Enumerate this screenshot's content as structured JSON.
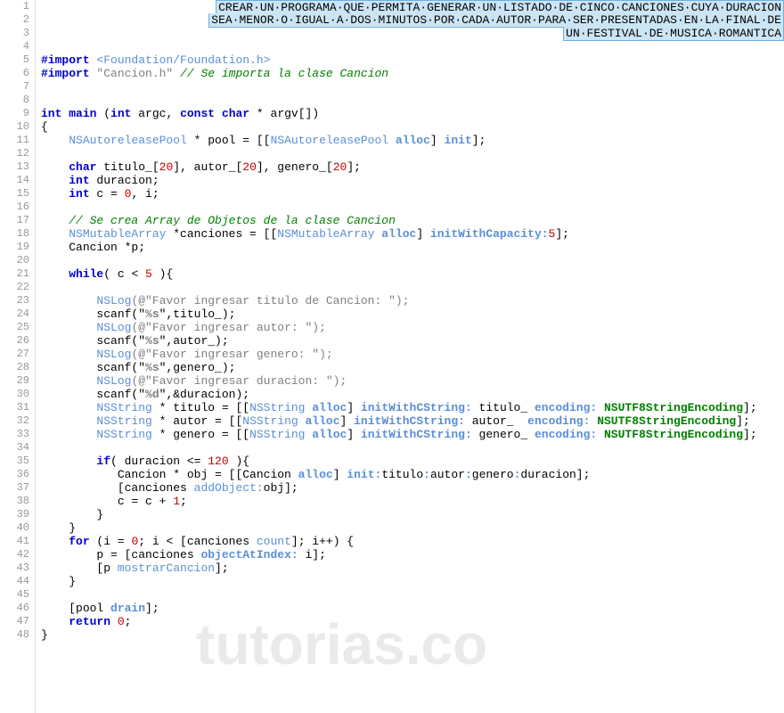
{
  "watermark": "tutorias.co",
  "header": {
    "line1": "CREAR·UN·PROGRAMA·QUE·PERMITA·GENERAR·UN·LISTADO·DE·CINCO·CANCIONES·CUYA·DURACION",
    "line2": "SEA·MENOR·O·IGUAL·A·DOS·MINUTOS·POR·CADA·AUTOR·PARA·SER·PRESENTADAS·EN·LA·FINAL·DE",
    "line3": "UN·FESTIVAL·DE·MUSICA·ROMANTICA"
  },
  "lineCount": 48,
  "code": {
    "import1_kw": "#import",
    "import1_path": "<Foundation/Foundation.h>",
    "import2_kw": "#import",
    "import2_path": "\"Cancion.h\"",
    "import2_cmt": "// Se importa la clase Cancion",
    "main_sig_int": "int",
    "main_sig_main": "main",
    "main_sig_int2": "int",
    "main_sig_argc": " argc, ",
    "main_sig_const": "const",
    "main_sig_char": "char",
    "main_sig_rest": " * argv[])",
    "pool_cls": "NSAutoreleasePool",
    "pool_mid": " * pool = [[",
    "pool_cls2": "NSAutoreleasePool",
    "pool_alloc": "alloc",
    "pool_init": "init",
    "char_kw": "char",
    "char_vars": " titulo_[",
    "char_20a": "20",
    "char_mid1": "], autor_[",
    "char_20b": "20",
    "char_mid2": "], genero_[",
    "char_20c": "20",
    "char_end": "];",
    "int_dur_kw": "int",
    "int_dur": " duracion;",
    "int_c_kw": "int",
    "int_c_mid": " c = ",
    "int_c_0": "0",
    "int_c_end": ", i;",
    "cmt_array": "// Se crea Array de Objetos de la clase Cancion",
    "nsma_cls": "NSMutableArray",
    "nsma_mid": " *canciones = [[",
    "nsma_cls2": "NSMutableArray",
    "nsma_alloc": "alloc",
    "nsma_init": "initWithCapacity:",
    "nsma_5": "5",
    "cancion_p": "Cancion *p;",
    "while_kw": "while",
    "while_cond": "( c < ",
    "while_5": "5",
    "while_end": " ){",
    "nslog": "NSLog",
    "nslog_titulo": "(@\"Favor ingresar titulo de Cancion: \");",
    "scanf_titulo": "scanf(\"",
    "fmt_s": "%s",
    "scanf_titulo_end": "\",titulo_);",
    "nslog_autor": "(@\"Favor ingresar autor: \");",
    "scanf_autor_end": "\",autor_);",
    "nslog_genero": "(@\"Favor ingresar genero: \");",
    "scanf_genero_end": "\",genero_);",
    "nslog_duracion": "(@\"Favor ingresar duracion: \");",
    "fmt_d": "%d",
    "scanf_duracion_end": "\",&duracion);",
    "nsstring": "NSString",
    "nsstring_titulo": " * titulo = [[",
    "nsstring_alloc": "alloc",
    "initcstr": "initWithCString:",
    "enc_kw": "encoding:",
    "enc_val": "NSUTF8StringEncoding",
    "ns_titulo_mid": " titulo_ ",
    "nsstring_autor": " * autor = [[",
    "ns_autor_mid": " autor_  ",
    "nsstring_genero": " * genero = [[",
    "ns_genero_mid": " genero_ ",
    "if_kw": "if",
    "if_cond": "( duracion <= ",
    "if_120": "120",
    "if_end": " ){",
    "cancion_obj": "Cancion * obj = [[Cancion ",
    "cancion_alloc": "alloc",
    "cancion_init": "init:",
    "cancion_params": "titulo",
    "cancion_c1": ":",
    "cancion_p2": "autor",
    "cancion_c2": ":",
    "cancion_p3": "genero",
    "cancion_c3": ":",
    "cancion_p4": "duracion];",
    "addobj": "[canciones ",
    "addobj_m": "addObject:",
    "addobj_end": "obj];",
    "c_inc": "c = c + ",
    "c_inc_1": "1",
    "c_inc_end": ";",
    "for_kw": "for",
    "for_start": " (i = ",
    "for_0": "0",
    "for_mid": "; i < [canciones ",
    "for_count": "count",
    "for_end": "]; i++) {",
    "p_assign": "p = [canciones ",
    "objAtIdx": "objectAtIndex:",
    "p_end": " i];",
    "mostrar": "[p ",
    "mostrar_m": "mostrarCancion",
    "mostrar_end": "];",
    "drain": "[pool ",
    "drain_m": "drain",
    "drain_end": "];",
    "return_kw": "return",
    "return_0": "0",
    "return_end": ";"
  }
}
